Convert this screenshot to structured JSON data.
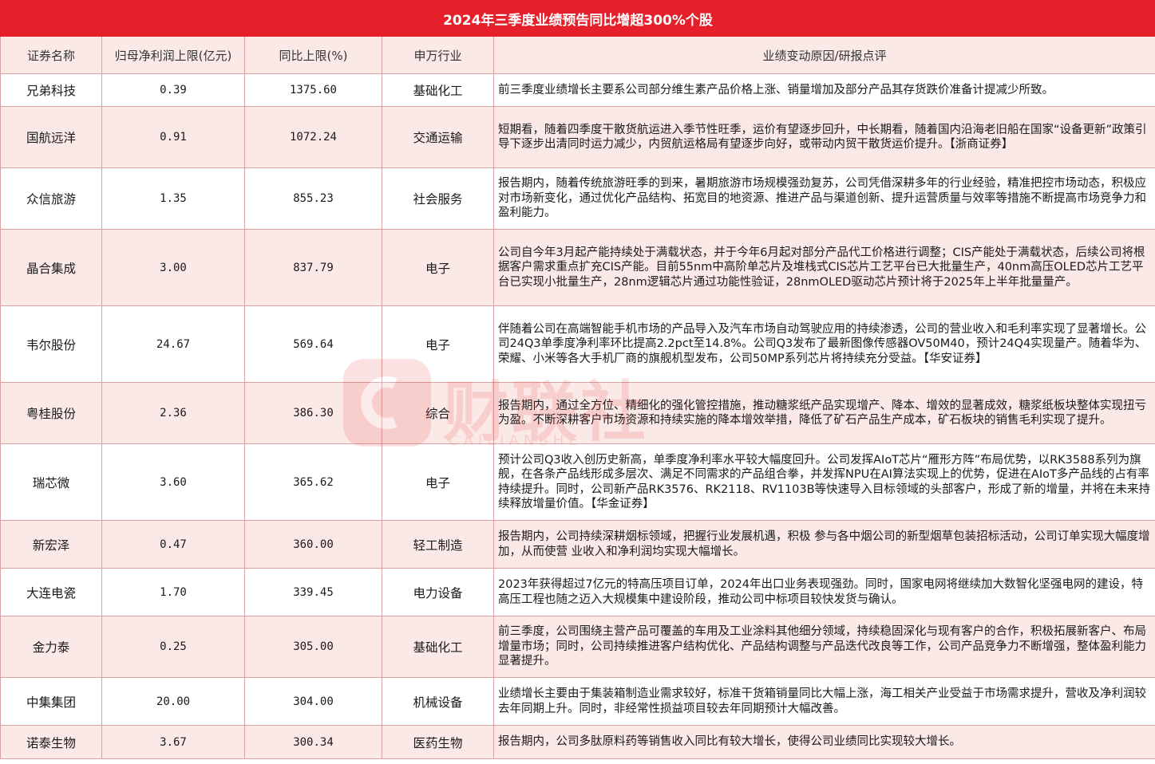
{
  "title": "2024年三季度业绩预告同比增超300%个股",
  "columns": [
    "证券名称",
    "归母净利润上限(亿元)",
    "同比上限(%)",
    "申万行业",
    "业绩变动原因/研报点评"
  ],
  "rows": [
    {
      "name": "兄弟科技",
      "profit": "0.39",
      "yoy": "1375.60",
      "industry": "基础化工",
      "reason": "前三季度业绩增长主要系公司部分维生素产品价格上涨、销量增加及部分产品其存货跌价准备计提减少所致。"
    },
    {
      "name": "国航远洋",
      "profit": "0.91",
      "yoy": "1072.24",
      "industry": "交通运输",
      "reason": "短期看，随着四季度干散货航运进入季节性旺季，运价有望逐步回升，中长期看，随着国内沿海老旧船在国家“设备更新”政策引导下逐步出清同时运力减少，内贸航运格局有望逐步向好，或带动内贸干散货运价提升。【浙商证券】"
    },
    {
      "name": "众信旅游",
      "profit": "1.35",
      "yoy": "855.23",
      "industry": "社会服务",
      "reason": "报告期内，随着传统旅游旺季的到来，暑期旅游市场规模强劲复苏，公司凭借深耕多年的行业经验，精准把控市场动态，积极应对市场新变化，通过优化产品结构、拓宽目的地资源、推进产品与渠道创新、提升运营质量与效率等措施不断提高市场竞争力和盈利能力。"
    },
    {
      "name": "晶合集成",
      "profit": "3.00",
      "yoy": "837.79",
      "industry": "电子",
      "reason": "公司自今年3月起产能持续处于满载状态，并于今年6月起对部分产品代工价格进行调整；CIS产能处于满载状态，后续公司将根据客户需求重点扩充CIS产能。目前55nm中高阶单芯片及堆栈式CIS芯片工艺平台已大批量生产，40nm高压OLED芯片工艺平台已实现小批量生产，28nm逻辑芯片通过功能性验证，28nmOLED驱动芯片预计将于2025年上半年批量量产。"
    },
    {
      "name": "韦尔股份",
      "profit": "24.67",
      "yoy": "569.64",
      "industry": "电子",
      "reason": "伴随着公司在高端智能手机市场的产品导入及汽车市场自动驾驶应用的持续渗透，公司的营业收入和毛利率实现了显著增长。公司24Q3单季度净利率环比提高2.2pct至14.8%。公司Q3发布了最新图像传感器OV50M40，预计24Q4实现量产。随着华为、荣耀、小米等各大手机厂商的旗舰机型发布，公司50MP系列芯片将持续充分受益。【华安证券】"
    },
    {
      "name": "粤桂股份",
      "profit": "2.36",
      "yoy": "386.30",
      "industry": "综合",
      "reason": "报告期内，通过全方位、精细化的强化管控措施，推动糖浆纸产品实现增产、降本、增效的显著成效，糖浆纸板块整体实现扭亏为盈。不断深耕客户市场资源和持续实施的降本增效举措，降低了矿石产品生产成本，矿石板块的销售毛利实现了提升。"
    },
    {
      "name": "瑞芯微",
      "profit": "3.60",
      "yoy": "365.62",
      "industry": "电子",
      "reason": "预计公司Q3收入创历史新高，单季度净利率水平较大幅度回升。公司发挥AIoT芯片“雁形方阵”布局优势，以RK3588系列为旗舰，在各条产品线形成多层次、满足不同需求的产品组合拳，并发挥NPU在AI算法实现上的优势，促进在AIoT多产品线的占有率持续提升。同时，公司新产品RK3576、RK2118、RV1103B等快速导入目标领域的头部客户，形成了新的增量，并将在未来持续释放增量价值。【华金证券】"
    },
    {
      "name": "新宏泽",
      "profit": "0.47",
      "yoy": "360.00",
      "industry": "轻工制造",
      "reason": "报告期内，公司持续深耕烟标领域，把握行业发展机遇，积极 参与各中烟公司的新型烟草包装招标活动，公司订单实现大幅度增加，从而使营 业收入和净利润均实现大幅增长。"
    },
    {
      "name": "大连电瓷",
      "profit": "1.70",
      "yoy": "339.45",
      "industry": "电力设备",
      "reason": "2023年获得超过7亿元的特高压项目订单，2024年出口业务表现强劲。同时，国家电网将继续加大数智化坚强电网的建设，特高压工程也随之迈入大规模集中建设阶段，推动公司中标项目较快发货与确认。"
    },
    {
      "name": "金力泰",
      "profit": "0.25",
      "yoy": "305.00",
      "industry": "基础化工",
      "reason": "前三季度，公司围绕主营产品可覆盖的车用及工业涂料其他细分领域，持续稳固深化与现有客户的合作，积极拓展新客户、布局增量市场；同时，公司持续推进客户结构优化、产品结构调整与产品迭代改良等工作，公司产品竞争力不断增强，整体盈利能力显著提升。"
    },
    {
      "name": "中集集团",
      "profit": "20.00",
      "yoy": "304.00",
      "industry": "机械设备",
      "reason": "业绩增长主要由于集装箱制造业需求较好，标准干货箱销量同比大幅上涨，海工相关产业受益于市场需求提升，营收及净利润较去年同期上升。同时，非经常性损益项目较去年同期预计大幅改善。"
    },
    {
      "name": "诺泰生物",
      "profit": "3.67",
      "yoy": "300.34",
      "industry": "医药生物",
      "reason": "报告期内，公司多肽原料药等销售收入同比有较大增长，使得公司业绩同比实现较大增长。"
    }
  ],
  "watermark": {
    "text": "财联社",
    "sub": "CAILIANSHE"
  },
  "colors": {
    "header_bg": "#e5202a",
    "stripe": "#fbe9e7",
    "border": "#d9a3a3"
  }
}
